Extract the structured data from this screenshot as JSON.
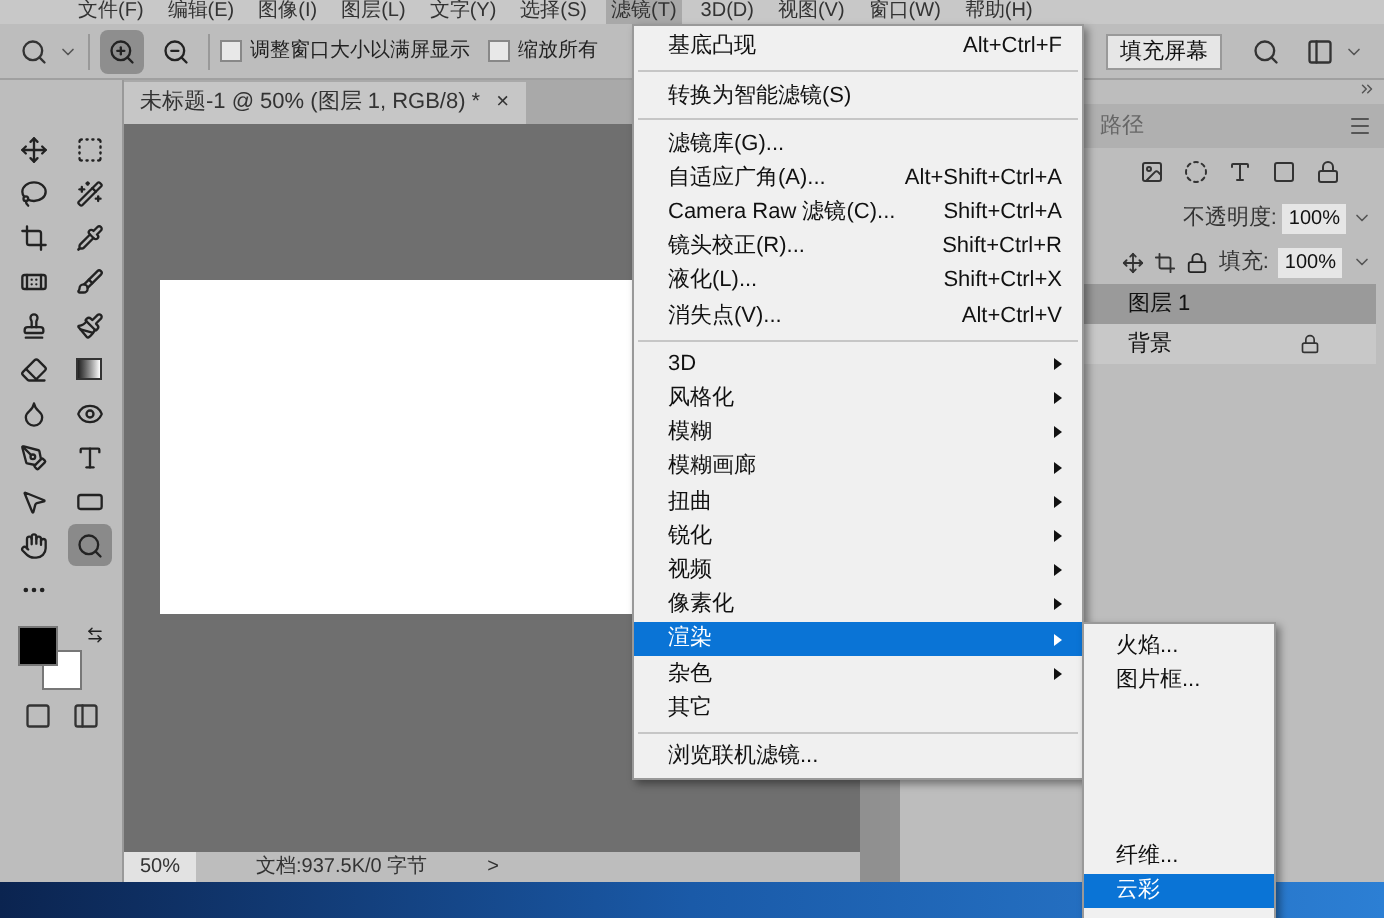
{
  "menu_bar": [
    {
      "label": "文件(F)",
      "selected": false
    },
    {
      "label": "编辑(E)",
      "selected": false
    },
    {
      "label": "图像(I)",
      "selected": false
    },
    {
      "label": "图层(L)",
      "selected": false
    },
    {
      "label": "文字(Y)",
      "selected": false
    },
    {
      "label": "选择(S)",
      "selected": false
    },
    {
      "label": "滤镜(T)",
      "selected": true
    },
    {
      "label": "3D(D)",
      "selected": false
    },
    {
      "label": "视图(V)",
      "selected": false
    },
    {
      "label": "窗口(W)",
      "selected": false
    },
    {
      "label": "帮助(H)",
      "selected": false
    }
  ],
  "options_bar": {
    "zoom_modes": [
      {
        "selected": true
      },
      {
        "selected": false
      }
    ],
    "checkboxes": [
      {
        "label": "调整窗口大小以满屏显示",
        "checked": false
      },
      {
        "label": "缩放所有",
        "checked": false
      }
    ],
    "fill_screen_button": "填充屏幕"
  },
  "tools": [
    {
      "selected": false
    },
    {
      "selected": false
    },
    {
      "selected": false
    },
    {
      "selected": false
    },
    {
      "selected": false
    },
    {
      "selected": false
    },
    {
      "selected": false
    },
    {
      "selected": false
    },
    {
      "selected": false
    },
    {
      "selected": false
    },
    {
      "selected": false
    },
    {
      "selected": false
    },
    {
      "selected": false
    },
    {
      "selected": false
    },
    {
      "selected": false
    },
    {
      "selected": false
    },
    {
      "selected": false
    },
    {
      "selected": false
    },
    {
      "selected": false
    },
    {
      "selected": true
    },
    {
      "selected": false
    }
  ],
  "document": {
    "tab_title": "未标题-1 @ 50% (图层 1, RGB/8) *",
    "close": "×",
    "zoom": "50%",
    "status": "文档:937.5K/0 字节",
    "status_arrow": ">"
  },
  "panel": {
    "tabs": [
      {
        "label": "路径",
        "selected": false
      }
    ],
    "opacity_label": "不透明度:",
    "opacity": "100%",
    "fill_label": "填充:",
    "fill": "100%",
    "layers": [
      {
        "name": "图层 1",
        "selected": true,
        "locked": false
      },
      {
        "name": "背景",
        "selected": false,
        "locked": true
      }
    ]
  },
  "filter_menu": [
    {
      "kind": "item",
      "label": "基底凸现",
      "shortcut": "Alt+Ctrl+F",
      "selected": false
    },
    {
      "kind": "separator"
    },
    {
      "kind": "item",
      "label": "转换为智能滤镜(S)",
      "selected": false
    },
    {
      "kind": "separator"
    },
    {
      "kind": "item",
      "label": "滤镜库(G)...",
      "selected": false
    },
    {
      "kind": "item",
      "label": "自适应广角(A)...",
      "shortcut": "Alt+Shift+Ctrl+A",
      "selected": false
    },
    {
      "kind": "item",
      "label": "Camera Raw 滤镜(C)...",
      "shortcut": "Shift+Ctrl+A",
      "selected": false
    },
    {
      "kind": "item",
      "label": "镜头校正(R)...",
      "shortcut": "Shift+Ctrl+R",
      "selected": false
    },
    {
      "kind": "item",
      "label": "液化(L)...",
      "shortcut": "Shift+Ctrl+X",
      "selected": false
    },
    {
      "kind": "item",
      "label": "消失点(V)...",
      "shortcut": "Alt+Ctrl+V",
      "selected": false
    },
    {
      "kind": "separator"
    },
    {
      "kind": "submenu",
      "label": "3D",
      "selected": false
    },
    {
      "kind": "submenu",
      "label": "风格化",
      "selected": false
    },
    {
      "kind": "submenu",
      "label": "模糊",
      "selected": false
    },
    {
      "kind": "submenu",
      "label": "模糊画廊",
      "selected": false
    },
    {
      "kind": "submenu",
      "label": "扭曲",
      "selected": false
    },
    {
      "kind": "submenu",
      "label": "锐化",
      "selected": false
    },
    {
      "kind": "submenu",
      "label": "视频",
      "selected": false
    },
    {
      "kind": "submenu",
      "label": "像素化",
      "selected": false
    },
    {
      "kind": "submenu",
      "label": "渲染",
      "selected": true
    },
    {
      "kind": "submenu",
      "label": "杂色",
      "selected": false
    },
    {
      "kind": "item",
      "label": "其它",
      "selected": false
    },
    {
      "kind": "separator"
    },
    {
      "kind": "item",
      "label": "浏览联机滤镜...",
      "selected": false
    }
  ],
  "render_submenu": [
    {
      "label": "火焰...",
      "selected": false
    },
    {
      "label": "图片框...",
      "selected": false
    },
    {
      "label": "纤维...",
      "selected": false
    },
    {
      "label": "云彩",
      "selected": true
    }
  ]
}
